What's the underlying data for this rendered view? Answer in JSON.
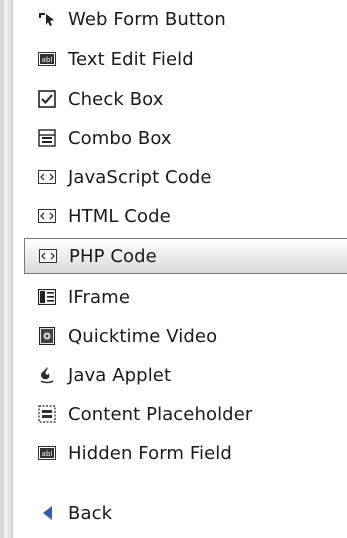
{
  "menu": {
    "items": [
      {
        "label": "Web Form Button",
        "icon": "cursor-button-icon"
      },
      {
        "label": "Text Edit Field",
        "icon": "text-field-icon"
      },
      {
        "label": "Check Box",
        "icon": "checkbox-icon"
      },
      {
        "label": "Combo Box",
        "icon": "combobox-icon"
      },
      {
        "label": "JavaScript Code",
        "icon": "code-icon"
      },
      {
        "label": "HTML Code",
        "icon": "code-icon"
      },
      {
        "label": "PHP Code",
        "icon": "code-icon",
        "selected": true
      },
      {
        "label": "IFrame",
        "icon": "iframe-icon"
      },
      {
        "label": "Quicktime Video",
        "icon": "video-icon"
      },
      {
        "label": "Java Applet",
        "icon": "java-icon"
      },
      {
        "label": "Content Placeholder",
        "icon": "placeholder-icon"
      },
      {
        "label": "Hidden Form Field",
        "icon": "hidden-field-icon"
      }
    ],
    "back_label": "Back"
  },
  "colors": {
    "text": "#1a1a1a",
    "selected_border": "#7a7a7a",
    "back_arrow": "#2f5fb0"
  }
}
